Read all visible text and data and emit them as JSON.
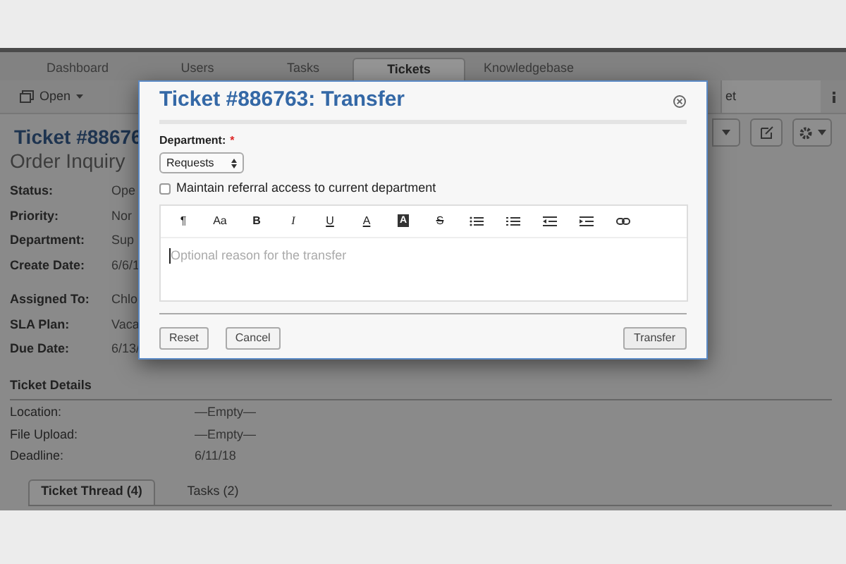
{
  "nav_tabs": [
    {
      "label": "Dashboard",
      "selected": false
    },
    {
      "label": "Users",
      "selected": false
    },
    {
      "label": "Tasks",
      "selected": false
    },
    {
      "label": "Tickets",
      "selected": true
    },
    {
      "label": "Knowledgebase",
      "selected": false
    }
  ],
  "toolbar": {
    "open_button": "Open",
    "right_tab": "et"
  },
  "ticket": {
    "title": "Ticket #88676",
    "subject": "Order Inquiry"
  },
  "fields_a": [
    {
      "label": "Status:",
      "value": "Ope"
    },
    {
      "label": "Priority:",
      "value": "Nor"
    },
    {
      "label": "Department:",
      "value": "Sup"
    },
    {
      "label": "Create Date:",
      "value": "6/6/1"
    }
  ],
  "fields_b": [
    {
      "label": "Assigned To:",
      "value": "Chlo"
    },
    {
      "label": "SLA Plan:",
      "value": "Vaca"
    },
    {
      "label": "Due Date:",
      "value": "6/13/"
    }
  ],
  "details": {
    "title": "Ticket Details",
    "rows": [
      {
        "label": "Location:",
        "value": "—Empty—"
      },
      {
        "label": "File Upload:",
        "value": "—Empty—"
      },
      {
        "label": "Deadline:",
        "value": "6/11/18"
      }
    ]
  },
  "thread_tabs": [
    {
      "label": "Ticket Thread (4)",
      "selected": true
    },
    {
      "label": "Tasks (2)",
      "selected": false
    }
  ],
  "modal": {
    "title": "Ticket #886763: Transfer",
    "department_label": "Department:",
    "required_mark": "*",
    "department_value": "Requests",
    "checkbox": {
      "label": "Maintain referral access to current department",
      "checked": false
    },
    "editor_tools": [
      {
        "kind": "text",
        "text": "¶"
      },
      {
        "kind": "text",
        "text": "Aa"
      },
      {
        "kind": "text",
        "text": "B"
      },
      {
        "kind": "text",
        "text": "I"
      },
      {
        "kind": "text",
        "text": "U"
      },
      {
        "kind": "text",
        "text": "A"
      },
      {
        "kind": "boxed",
        "text": "A"
      },
      {
        "kind": "text",
        "text": "S"
      },
      {
        "kind": "bullets"
      },
      {
        "kind": "numbers"
      },
      {
        "kind": "outdent"
      },
      {
        "kind": "indent"
      },
      {
        "kind": "link"
      }
    ],
    "placeholder": "Optional reason for the transfer",
    "buttons": [
      "Reset",
      "Cancel"
    ],
    "submit": "Transfer"
  }
}
